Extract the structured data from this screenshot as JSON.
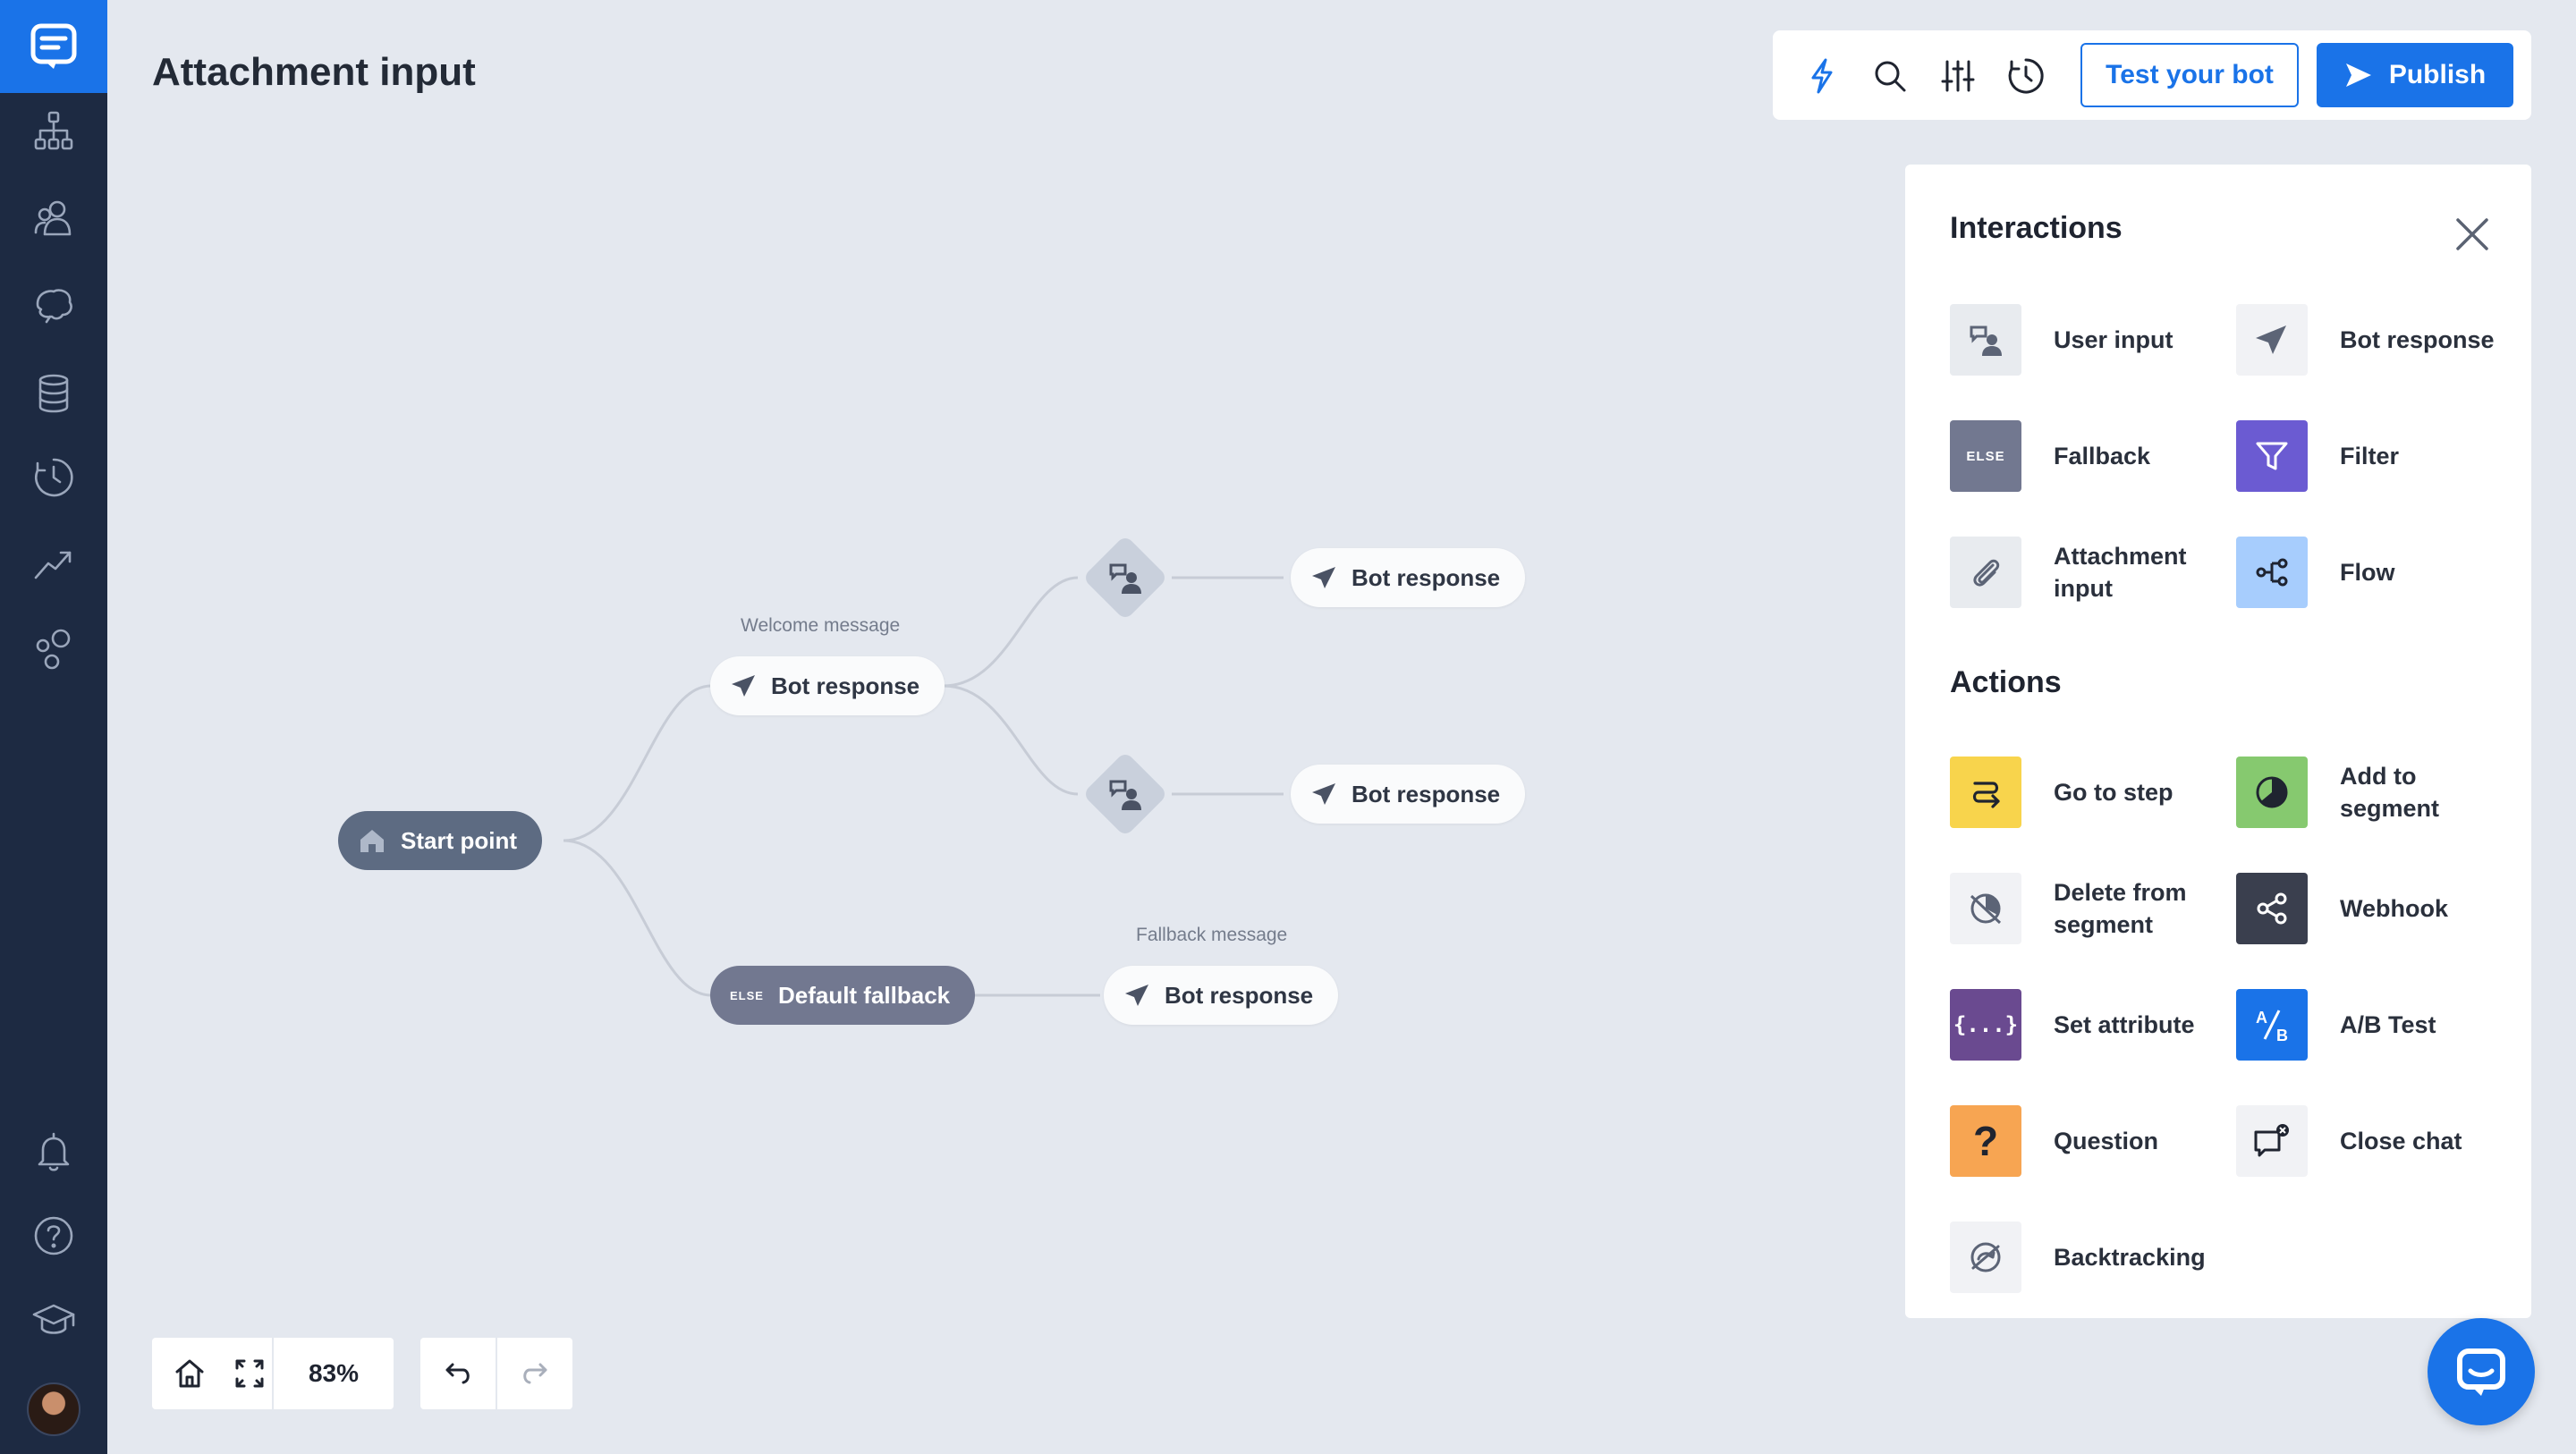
{
  "page": {
    "title": "Attachment input"
  },
  "sidebar": {
    "items": [
      "logo-chat",
      "structure",
      "audience",
      "training",
      "data",
      "history",
      "reports",
      "integrations",
      "notifications",
      "help",
      "academy",
      "avatar"
    ]
  },
  "toolbar": {
    "test_label": "Test your bot",
    "publish_label": "Publish"
  },
  "canvas": {
    "start": "Start point",
    "welcome_label": "Welcome message",
    "welcome_node": "Bot response",
    "branch_top_node": "Bot response",
    "branch_bottom_node": "Bot response",
    "fallback_label": "Fallback message",
    "default_fallback": "Default fallback",
    "else_tag": "ELSE",
    "fallback_node": "Bot response"
  },
  "panel": {
    "interactions_title": "Interactions",
    "actions_title": "Actions",
    "interactions": [
      {
        "label": "User input",
        "color": "#e8ebef"
      },
      {
        "label": "Bot response",
        "color": "#f1f2f5"
      },
      {
        "label": "Fallback",
        "color": "#727890"
      },
      {
        "label": "Filter",
        "color": "#6b5bd2"
      },
      {
        "label": "Attachment input",
        "color": "#e8ebef"
      },
      {
        "label": "Flow",
        "color": "#a7cdfd"
      }
    ],
    "actions": [
      {
        "label": "Go to step",
        "color": "#f8d44c"
      },
      {
        "label": "Add to segment",
        "color": "#86c96f"
      },
      {
        "label": "Delete from segment",
        "color": "#f1f2f5"
      },
      {
        "label": "Webhook",
        "color": "#3a3f4e"
      },
      {
        "label": "Set attribute",
        "color": "#6a4a90"
      },
      {
        "label": "A/B Test",
        "color": "#1a73e8"
      },
      {
        "label": "Question",
        "color": "#f7a552"
      },
      {
        "label": "Close chat",
        "color": "#f1f2f5"
      },
      {
        "label": "Backtracking",
        "color": "#f1f2f5"
      }
    ]
  },
  "controls": {
    "zoom": "83%"
  }
}
